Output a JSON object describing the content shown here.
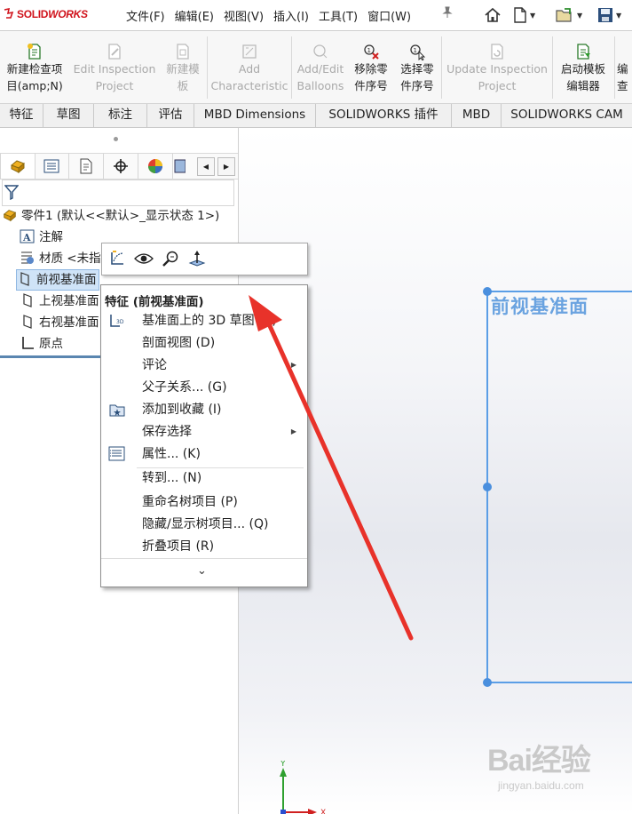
{
  "app": {
    "brand_prefix": "3S",
    "brand_solid": "SOLID",
    "brand_works": "WORKS"
  },
  "menubar": {
    "items": [
      "文件(F)",
      "编辑(E)",
      "视图(V)",
      "插入(I)",
      "工具(T)",
      "窗口(W)"
    ]
  },
  "commands": [
    {
      "label1": "新建检查项",
      "label2": "目(amp;N)",
      "enabled": true,
      "icon": "new-inspection-icon"
    },
    {
      "label1": "Edit Inspection",
      "label2": "Project",
      "enabled": false,
      "icon": "edit-inspection-icon"
    },
    {
      "label1": "新建模",
      "label2": "板",
      "enabled": false,
      "icon": "new-template-icon"
    },
    {
      "label1": "Add",
      "label2": "Characteristic",
      "enabled": false,
      "icon": "add-characteristic-icon"
    },
    {
      "label1": "Add/Edit",
      "label2": "Balloons",
      "enabled": false,
      "icon": "balloons-icon"
    },
    {
      "label1": "移除零",
      "label2": "件序号",
      "enabled": true,
      "icon": "remove-balloon-icon"
    },
    {
      "label1": "选择零",
      "label2": "件序号",
      "enabled": true,
      "icon": "select-balloon-icon"
    },
    {
      "label1": "Update Inspection",
      "label2": "Project",
      "enabled": false,
      "icon": "update-inspection-icon"
    },
    {
      "label1": "启动模板",
      "label2": "编辑器",
      "enabled": true,
      "icon": "template-editor-icon"
    },
    {
      "label1": "编",
      "label2": "查",
      "enabled": true,
      "icon": "truncated-icon"
    }
  ],
  "tabs": [
    "特征",
    "草图",
    "标注",
    "评估",
    "MBD Dimensions",
    "SOLIDWORKS 插件",
    "MBD",
    "SOLIDWORKS CAM"
  ],
  "tree": {
    "root": "零件1  (默认<<默认>_显示状态 1>)",
    "items": [
      "注解",
      "材质 <未指",
      "前视基准面",
      "上视基准面",
      "右视基准面",
      "原点"
    ],
    "selected_index": 2
  },
  "graphics": {
    "plane_label": "前视基准面",
    "triad_x": "X",
    "triad_y": "Y",
    "watermark_big": "Bai经验",
    "watermark_small": "jingyan.baidu.com"
  },
  "context_menu": {
    "title": "特征 (前视基准面)",
    "items": [
      {
        "label": "基准面上的 3D 草图 (C)",
        "icon": "3d-sketch-icon",
        "submenu": false
      },
      {
        "label": "剖面视图 (D)",
        "icon": "",
        "submenu": false
      },
      {
        "label": "评论",
        "icon": "",
        "submenu": true
      },
      {
        "label": "父子关系... (G)",
        "icon": "",
        "submenu": false
      },
      {
        "label": "添加到收藏 (I)",
        "icon": "favorite-icon",
        "submenu": false
      },
      {
        "label": "保存选择",
        "icon": "",
        "submenu": true
      },
      {
        "label": "属性... (K)",
        "icon": "properties-icon",
        "submenu": false
      },
      {
        "label": "转到... (N)",
        "icon": "",
        "submenu": false
      },
      {
        "label": "重命名树项目 (P)",
        "icon": "",
        "submenu": false
      },
      {
        "label": "隐藏/显示树项目... (Q)",
        "icon": "",
        "submenu": false
      },
      {
        "label": "折叠项目 (R)",
        "icon": "",
        "submenu": false
      }
    ],
    "more": "⌄"
  },
  "colors": {
    "brand_red": "#d0121b",
    "selection_blue": "#5b9ee6",
    "arrow_red": "#e8322a"
  }
}
